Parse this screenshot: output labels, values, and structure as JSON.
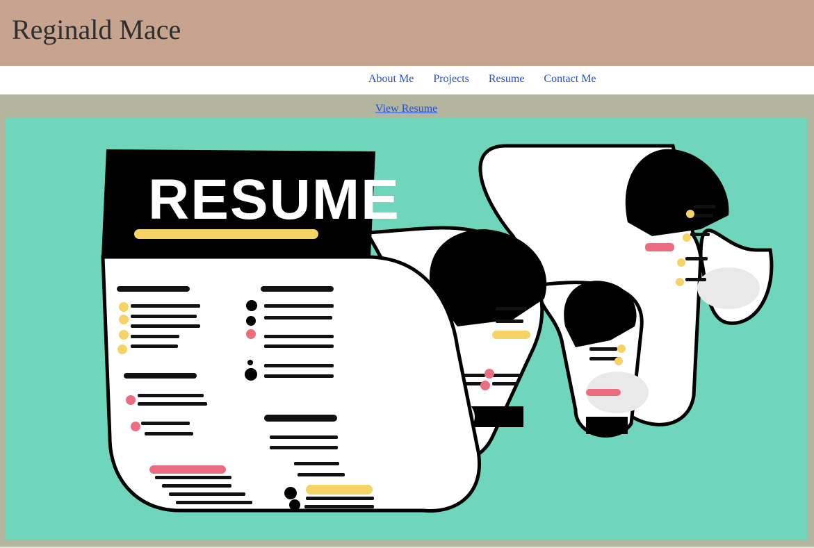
{
  "header": {
    "title": "Reginald Mace"
  },
  "nav": {
    "items": [
      {
        "label": "About Me"
      },
      {
        "label": "Projects"
      },
      {
        "label": "Resume"
      },
      {
        "label": "Contact Me"
      }
    ]
  },
  "resume": {
    "view_link": "View Resume",
    "illustration_heading": "RESUME"
  },
  "colors": {
    "header_bg": "#c6a490",
    "page_bg": "#b3b59f",
    "illustration_bg": "#6fd5bb",
    "link": "#2350d6",
    "accent_yellow": "#f5d365",
    "accent_pink": "#ec6c80"
  }
}
